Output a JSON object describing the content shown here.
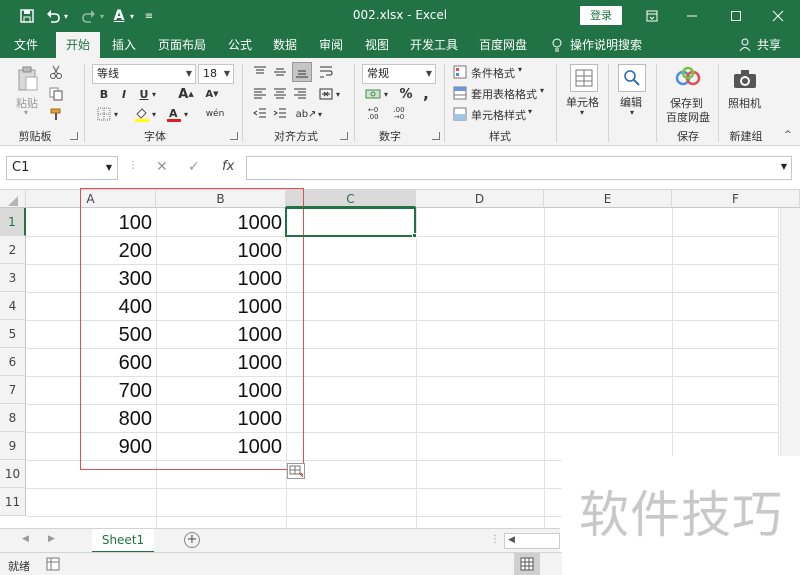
{
  "titlebar": {
    "title": "002.xlsx  -  Excel",
    "login": "登录"
  },
  "tabs": [
    "文件",
    "开始",
    "插入",
    "页面布局",
    "公式",
    "数据",
    "审阅",
    "视图",
    "开发工具",
    "百度网盘"
  ],
  "tell_me": "操作说明搜索",
  "share": "共享",
  "ribbon": {
    "clipboard": {
      "paste": "粘贴",
      "label": "剪贴板"
    },
    "font": {
      "name": "等线",
      "size": "18",
      "label": "字体"
    },
    "alignment": {
      "label": "对齐方式"
    },
    "number": {
      "format": "常规",
      "label": "数字"
    },
    "styles": {
      "conditional": "条件格式",
      "table": "套用表格格式",
      "cell": "单元格样式",
      "label": "样式"
    },
    "cells": {
      "label": "单元格"
    },
    "editing": {
      "label": "编辑"
    },
    "save": {
      "label1": "保存到",
      "label2": "百度网盘",
      "group": "保存"
    },
    "camera": {
      "label": "照相机",
      "group": "新建组"
    }
  },
  "formula_bar": {
    "name_box": "C1",
    "value": ""
  },
  "columns": [
    "A",
    "B",
    "C",
    "D",
    "E",
    "F"
  ],
  "rows": [
    "1",
    "2",
    "3",
    "4",
    "5",
    "6",
    "7",
    "8",
    "9",
    "10",
    "11"
  ],
  "cells_a": [
    "100",
    "200",
    "300",
    "400",
    "500",
    "600",
    "700",
    "800",
    "900"
  ],
  "cells_b": [
    "1000",
    "1000",
    "1000",
    "1000",
    "1000",
    "1000",
    "1000",
    "1000",
    "1000"
  ],
  "sheet_tab": "Sheet1",
  "status": "就绪",
  "watermark": "软件技巧",
  "colors": {
    "accent": "#217346",
    "range": "#e05050"
  }
}
